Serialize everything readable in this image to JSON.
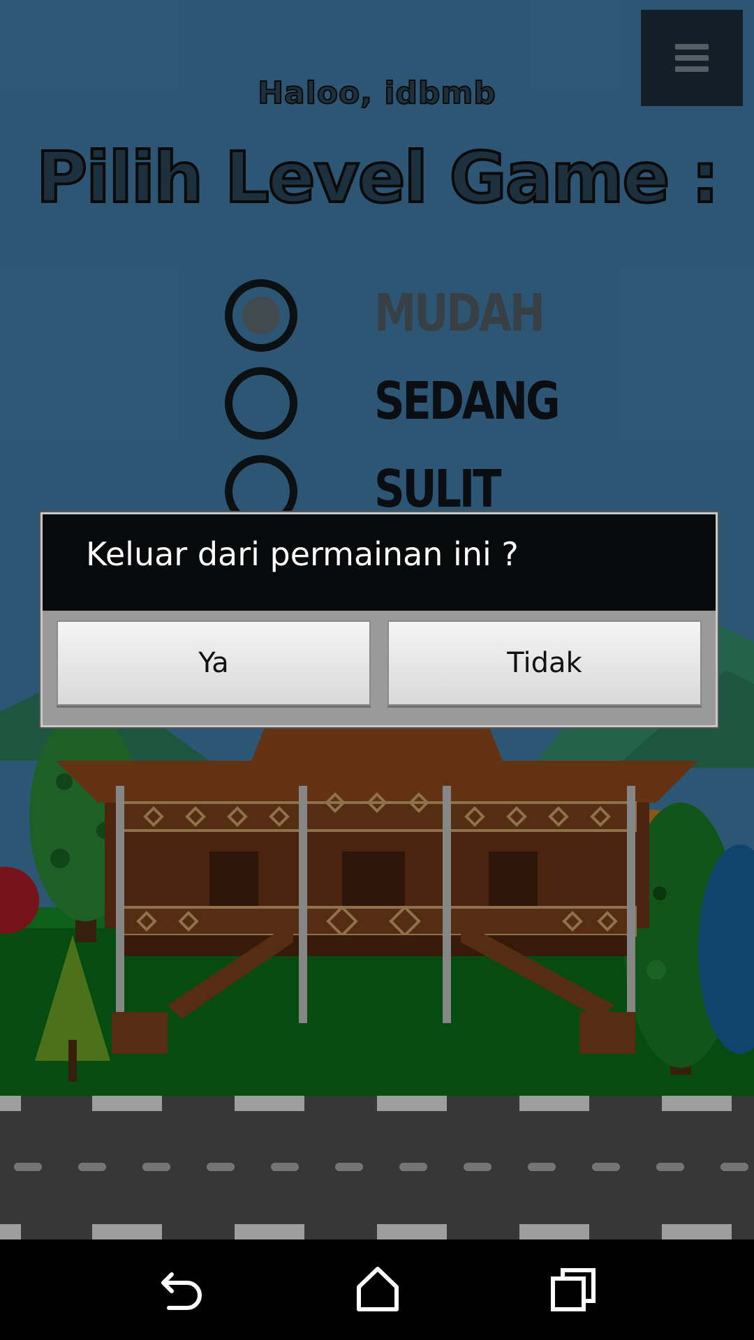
{
  "header": {
    "greeting": "Haloo, idbmb",
    "title": "Pilih Level Game :"
  },
  "menu": {
    "icon": "hamburger-menu-icon"
  },
  "levels": [
    {
      "label": "MUDAH",
      "selected": true
    },
    {
      "label": "SEDANG",
      "selected": false
    },
    {
      "label": "SULIT",
      "selected": false
    }
  ],
  "dialog": {
    "message": "Keluar dari permainan ini ?",
    "yes_label": "Ya",
    "no_label": "Tidak"
  },
  "navbar": {
    "back_icon": "back-icon",
    "home_icon": "home-icon",
    "recents_icon": "recents-icon"
  },
  "colors": {
    "sky": "#4a8cbd",
    "grass": "#0a7a1a",
    "road": "#5a5a5a",
    "house": "#7a3b1a",
    "dialog_header": "#07090b"
  }
}
